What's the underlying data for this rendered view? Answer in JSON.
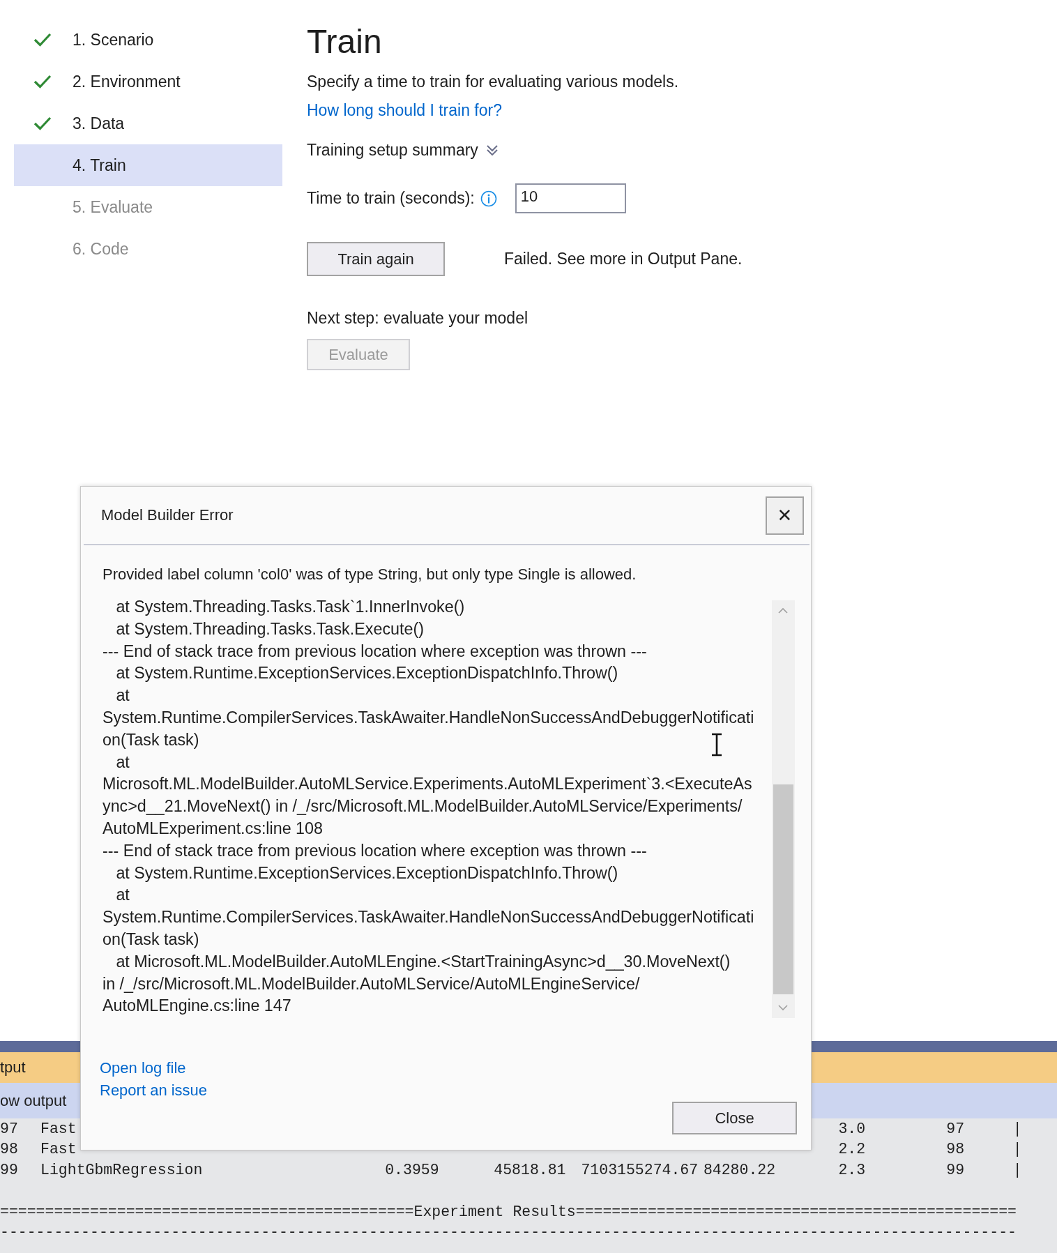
{
  "steps": [
    {
      "label": "1. Scenario",
      "completed": true,
      "disabled": false,
      "selected": false
    },
    {
      "label": "2. Environment",
      "completed": true,
      "disabled": false,
      "selected": false
    },
    {
      "label": "3. Data",
      "completed": true,
      "disabled": false,
      "selected": false
    },
    {
      "label": "4. Train",
      "completed": false,
      "disabled": false,
      "selected": true
    },
    {
      "label": "5. Evaluate",
      "completed": false,
      "disabled": true,
      "selected": false
    },
    {
      "label": "6. Code",
      "completed": false,
      "disabled": true,
      "selected": false
    }
  ],
  "train": {
    "title": "Train",
    "description": "Specify a time to train for evaluating various models.",
    "help_link": "How long should I train for?",
    "summary_toggle": {
      "label": "Training setup summary",
      "expanded": false
    },
    "time_field": {
      "label": "Time to train (seconds):",
      "value": "10"
    },
    "train_button": "Train again",
    "status_text": "Failed. See more in Output Pane.",
    "next_step": "Next step: evaluate your model",
    "evaluate_button": {
      "label": "Evaluate",
      "disabled": true
    }
  },
  "output_pane": {
    "title": "tput",
    "source": "ow output",
    "rows": [
      {
        "column_1": "97",
        "column_2": "Fast",
        "column_7": "3.0",
        "column_8": "97",
        "column_9": "|"
      },
      {
        "column_1": "98",
        "column_2": "Fast",
        "column_7": "2.2",
        "column_8": "98",
        "column_9": "|"
      },
      {
        "column_1": "99",
        "column_2": "LightGbmRegression",
        "column_3": "0.3959",
        "column_4": "45818.81",
        "column_5": "7103155274.67",
        "column_6": "84280.22",
        "column_7": "2.3",
        "column_8": "99",
        "column_9": "|"
      }
    ],
    "lines": [
      {
        "kind": "text",
        "text": "==============================================Experiment Results================================================="
      },
      {
        "kind": "text",
        "text": "-----------------------------------------------------------------------------------------------------------------"
      }
    ]
  },
  "dialog": {
    "title": "Model Builder Error",
    "close_icon": "✕",
    "message": "Provided label column 'col0' was of type String, but only type Single is allowed.",
    "trace": [
      "   at System.Threading.Tasks.Task`1.InnerInvoke()",
      "   at System.Threading.Tasks.Task.Execute()",
      "--- End of stack trace from previous location where exception was thrown ---",
      "   at System.Runtime.ExceptionServices.ExceptionDispatchInfo.Throw()",
      "   at",
      "System.Runtime.CompilerServices.TaskAwaiter.HandleNonSuccessAndDebuggerNotificati",
      "on(Task task)",
      "   at",
      "Microsoft.ML.ModelBuilder.AutoMLService.Experiments.AutoMLExperiment`3.<ExecuteAs",
      "ync>d__21.MoveNext() in /_/src/Microsoft.ML.ModelBuilder.AutoMLService/Experiments/",
      "AutoMLExperiment.cs:line 108",
      "--- End of stack trace from previous location where exception was thrown ---",
      "   at System.Runtime.ExceptionServices.ExceptionDispatchInfo.Throw()",
      "   at",
      "System.Runtime.CompilerServices.TaskAwaiter.HandleNonSuccessAndDebuggerNotificati",
      "on(Task task)",
      "   at Microsoft.ML.ModelBuilder.AutoMLEngine.<StartTrainingAsync>d__30.MoveNext()",
      "in /_/src/Microsoft.ML.ModelBuilder.AutoMLService/AutoMLEngineService/",
      "AutoMLEngine.cs:line 147"
    ],
    "links": [
      "Open log file",
      "Report an issue"
    ],
    "close_button": "Close"
  }
}
